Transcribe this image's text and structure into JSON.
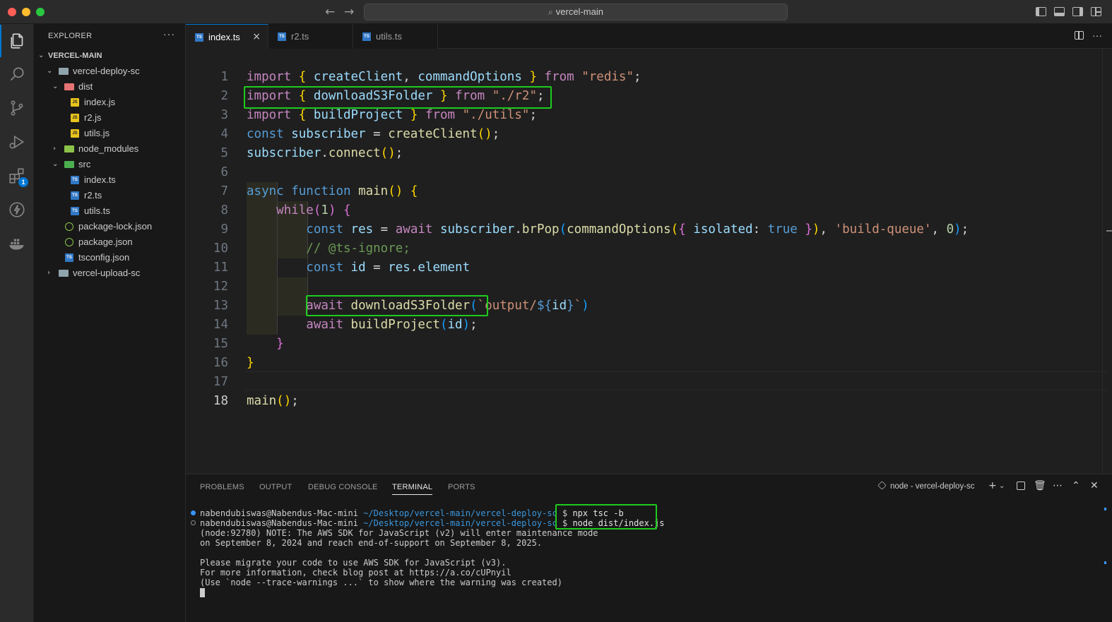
{
  "titlebar": {
    "search_text": "vercel-main",
    "back_icon": "arrow-left-icon",
    "forward_icon": "arrow-right-icon"
  },
  "activity": [
    "explorer-icon",
    "search-icon",
    "source-control-icon",
    "run-debug-icon",
    "extensions-icon",
    "lightning-icon",
    "docker-icon"
  ],
  "extensions_badge": "1",
  "sidebar": {
    "header": "EXPLORER",
    "more": "···",
    "root": "VERCEL-MAIN",
    "tree": {
      "deploy": "vercel-deploy-sc",
      "dist": "dist",
      "dist_index": "index.js",
      "dist_r2": "r2.js",
      "dist_utils": "utils.js",
      "node_modules": "node_modules",
      "src": "src",
      "src_index": "index.ts",
      "src_r2": "r2.ts",
      "src_utils": "utils.ts",
      "package_lock": "package-lock.json",
      "package": "package.json",
      "tsconfig": "tsconfig.json",
      "upload": "vercel-upload-sc"
    }
  },
  "tabs": {
    "t1": "index.ts",
    "t2": "r2.ts",
    "t3": "utils.ts",
    "close": "×",
    "actions": "···"
  },
  "editor": {
    "current_line": 18,
    "line_numbers": [
      "1",
      "2",
      "3",
      "4",
      "5",
      "6",
      "7",
      "8",
      "9",
      "10",
      "11",
      "12",
      "13",
      "14",
      "15",
      "16",
      "17",
      "18"
    ]
  },
  "panel": {
    "tabs": {
      "problems": "PROBLEMS",
      "output": "OUTPUT",
      "debug": "DEBUG CONSOLE",
      "terminal": "TERMINAL",
      "ports": "PORTS"
    },
    "terminal_name": "node - vercel-deploy-sc",
    "prompt_user": "nabendubiswas@Nabendus-Mac-mini",
    "prompt_path": "~/Desktop/vercel-main/vercel-deploy-sc",
    "prompt_symbol": "$",
    "cmd1": "npx tsc -b",
    "cmd2": "node dist/index.js",
    "out1": "(node:92780) NOTE: The AWS SDK for JavaScript (v2) will enter maintenance mode",
    "out2": "on September 8, 2024 and reach end-of-support on September 8, 2025.",
    "out3": "Please migrate your code to use AWS SDK for JavaScript (v3).",
    "out4": "For more information, check blog post at https://a.co/cUPnyil",
    "out5": "(Use `node --trace-warnings ...` to show where the warning was created)"
  }
}
